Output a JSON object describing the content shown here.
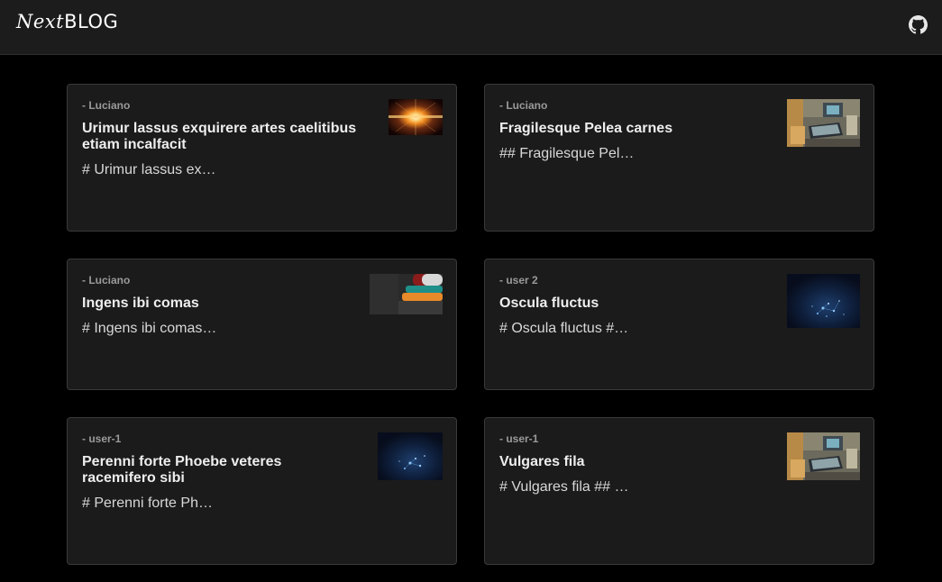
{
  "header": {
    "logo_next": "Next",
    "logo_blog": "BLOG",
    "github_icon": "github-icon"
  },
  "posts": [
    {
      "author": "- Luciano",
      "title": "Urimur lassus exquirere artes caelitibus etiam incalfacit",
      "excerpt": "# Urimur lassus ex…",
      "thumbnail": "sunburst-image"
    },
    {
      "author": "- Luciano",
      "title": "Fragilesque Pelea carnes",
      "excerpt": "## Fragilesque Pel…",
      "thumbnail": "desk-laptop-image"
    },
    {
      "author": "- Luciano",
      "title": "Ingens ibi comas",
      "excerpt": "# Ingens ibi comas…",
      "thumbnail": "stacked-books-image"
    },
    {
      "author": "- user 2",
      "title": "Oscula fluctus",
      "excerpt": "# Oscula fluctus #…",
      "thumbnail": "network-lights-image"
    },
    {
      "author": "- user-1",
      "title": "Perenni forte Phoebe veteres racemifero sibi",
      "excerpt": "# Perenni forte Ph…",
      "thumbnail": "network-lights-image"
    },
    {
      "author": "- user-1",
      "title": "Vulgares fila",
      "excerpt": "# Vulgares fila ## …",
      "thumbnail": "desk-laptop-image"
    }
  ],
  "colors": {
    "page_bg": "#000000",
    "header_bg": "#1c1c1c",
    "card_bg": "#1b1b1b",
    "card_border": "#3a3a3a",
    "author_text": "#9a9a9a",
    "title_text": "#eeeeee"
  }
}
